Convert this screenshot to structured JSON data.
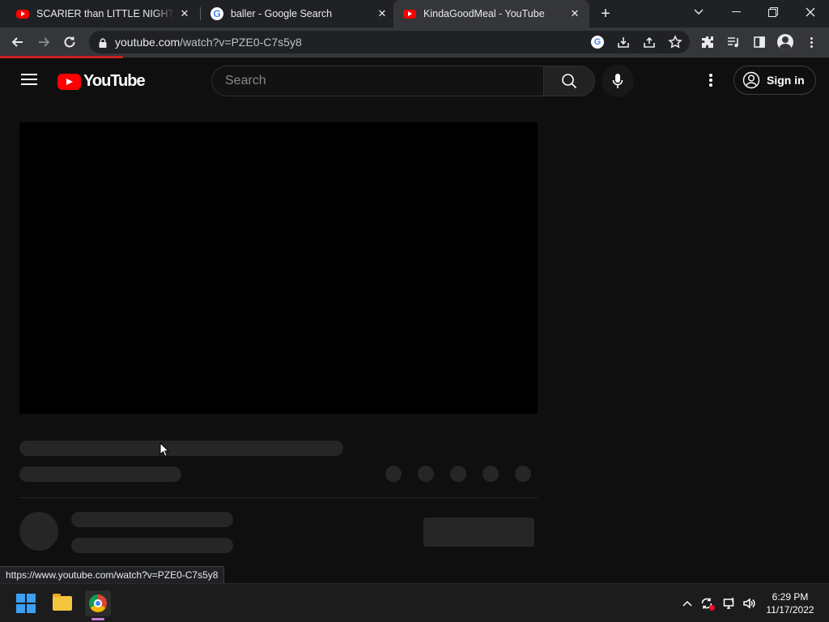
{
  "browser": {
    "tabs": [
      {
        "title": "SCARIER than LITTLE NIGHTMARES",
        "favicon": "youtube-icon",
        "active": false
      },
      {
        "title": "baller - Google Search",
        "favicon": "google-icon",
        "active": false
      },
      {
        "title": "KindaGoodMeal - YouTube",
        "favicon": "youtube-icon",
        "active": true
      }
    ],
    "address": {
      "host": "youtube.com",
      "path": "/watch?v=PZE0-C7s5y8"
    },
    "status_url": "https://www.youtube.com/watch?v=PZE0-C7s5y8",
    "loading_color": "#c5221f"
  },
  "youtube": {
    "logo_text": "YouTube",
    "search_placeholder": "Search",
    "signin_label": "Sign in",
    "brand_color": "#ff0000"
  },
  "taskbar": {
    "time": "6:29 PM",
    "date": "11/17/2022",
    "pinned": [
      "windows-start-icon",
      "file-explorer-icon",
      "chrome-icon"
    ]
  }
}
